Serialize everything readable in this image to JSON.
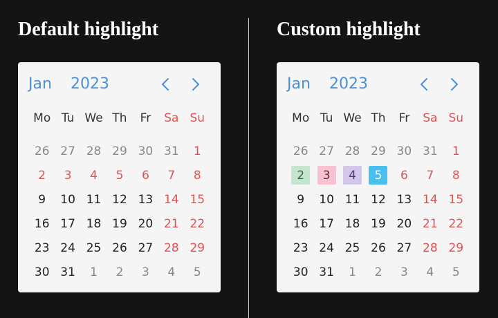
{
  "left": {
    "title": "Default highlight",
    "calendar": {
      "month": "Jan",
      "year": "2023",
      "weekdays": [
        "Mo",
        "Tu",
        "We",
        "Th",
        "Fr",
        "Sa",
        "Su"
      ],
      "days": [
        {
          "label": "26",
          "other": true
        },
        {
          "label": "27",
          "other": true
        },
        {
          "label": "28",
          "other": true
        },
        {
          "label": "29",
          "other": true
        },
        {
          "label": "30",
          "other": true
        },
        {
          "label": "31",
          "other": true
        },
        {
          "label": "1",
          "weekend": true
        },
        {
          "label": "2",
          "weekend": true
        },
        {
          "label": "3",
          "weekend": true
        },
        {
          "label": "4",
          "weekend": true
        },
        {
          "label": "5",
          "weekend": true
        },
        {
          "label": "6",
          "weekend": true
        },
        {
          "label": "7",
          "weekend": true
        },
        {
          "label": "8",
          "weekend": true
        },
        {
          "label": "9"
        },
        {
          "label": "10"
        },
        {
          "label": "11"
        },
        {
          "label": "12"
        },
        {
          "label": "13"
        },
        {
          "label": "14",
          "weekend": true
        },
        {
          "label": "15",
          "weekend": true
        },
        {
          "label": "16"
        },
        {
          "label": "17"
        },
        {
          "label": "18"
        },
        {
          "label": "19"
        },
        {
          "label": "20"
        },
        {
          "label": "21",
          "weekend": true
        },
        {
          "label": "22",
          "weekend": true
        },
        {
          "label": "23"
        },
        {
          "label": "24"
        },
        {
          "label": "25"
        },
        {
          "label": "26"
        },
        {
          "label": "27"
        },
        {
          "label": "28",
          "weekend": true
        },
        {
          "label": "29",
          "weekend": true
        },
        {
          "label": "30"
        },
        {
          "label": "31"
        },
        {
          "label": "1",
          "other": true
        },
        {
          "label": "2",
          "other": true
        },
        {
          "label": "3",
          "other": true
        },
        {
          "label": "4",
          "other": true
        },
        {
          "label": "5",
          "other": true
        }
      ]
    }
  },
  "right": {
    "title": "Custom highlight",
    "calendar": {
      "month": "Jan",
      "year": "2023",
      "weekdays": [
        "Mo",
        "Tu",
        "We",
        "Th",
        "Fr",
        "Sa",
        "Su"
      ],
      "days": [
        {
          "label": "26",
          "other": true
        },
        {
          "label": "27",
          "other": true
        },
        {
          "label": "28",
          "other": true
        },
        {
          "label": "29",
          "other": true
        },
        {
          "label": "30",
          "other": true
        },
        {
          "label": "31",
          "other": true
        },
        {
          "label": "1",
          "weekend": true
        },
        {
          "label": "2",
          "highlight": {
            "bg": "#c6e5cf",
            "fg": "#2d6a3f"
          }
        },
        {
          "label": "3",
          "highlight": {
            "bg": "#f8c3d0",
            "fg": "#6e1f35"
          }
        },
        {
          "label": "4",
          "highlight": {
            "bg": "#d3c6e8",
            "fg": "#4b3a78"
          }
        },
        {
          "label": "5",
          "highlight": {
            "bg": "#49bff0",
            "fg": "#ffffff"
          }
        },
        {
          "label": "6",
          "weekend": true
        },
        {
          "label": "7",
          "weekend": true
        },
        {
          "label": "8",
          "weekend": true
        },
        {
          "label": "9"
        },
        {
          "label": "10"
        },
        {
          "label": "11"
        },
        {
          "label": "12"
        },
        {
          "label": "13"
        },
        {
          "label": "14",
          "weekend": true
        },
        {
          "label": "15",
          "weekend": true
        },
        {
          "label": "16"
        },
        {
          "label": "17"
        },
        {
          "label": "18"
        },
        {
          "label": "19"
        },
        {
          "label": "20"
        },
        {
          "label": "21",
          "weekend": true
        },
        {
          "label": "22",
          "weekend": true
        },
        {
          "label": "23"
        },
        {
          "label": "24"
        },
        {
          "label": "25"
        },
        {
          "label": "26"
        },
        {
          "label": "27"
        },
        {
          "label": "28",
          "weekend": true
        },
        {
          "label": "29",
          "weekend": true
        },
        {
          "label": "30"
        },
        {
          "label": "31"
        },
        {
          "label": "1",
          "other": true
        },
        {
          "label": "2",
          "other": true
        },
        {
          "label": "3",
          "other": true
        },
        {
          "label": "4",
          "other": true
        },
        {
          "label": "5",
          "other": true
        }
      ]
    }
  },
  "colors": {
    "background": "#141414",
    "accent": "#4a90d9",
    "weekend": "#e05252",
    "other_month": "#888888"
  },
  "icons": {
    "prev": "chevron-left-icon",
    "next": "chevron-right-icon"
  }
}
